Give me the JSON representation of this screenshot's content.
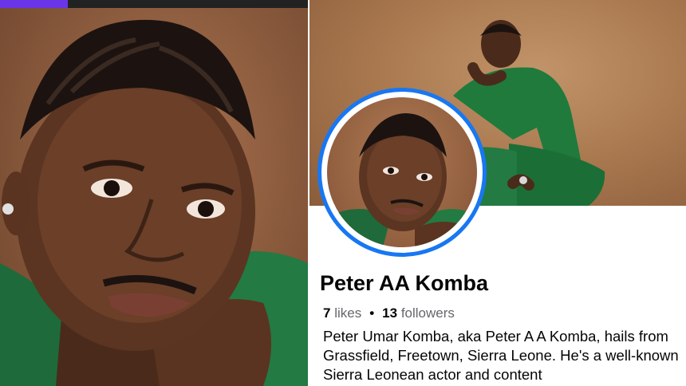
{
  "story": {
    "progress_fraction": 0.22,
    "progress_color": "#6a35e8"
  },
  "profile": {
    "name": "Peter AA Komba",
    "likes_count": "7",
    "likes_label": "likes",
    "followers_count": "13",
    "followers_label": "followers",
    "separator": "•",
    "bio": "Peter Umar Komba, aka Peter A A Komba, hails from Grassfield, Freetown, Sierra Leone. He's a well-known Sierra Leonean actor and content",
    "avatar_ring_color": "#1877f2"
  }
}
